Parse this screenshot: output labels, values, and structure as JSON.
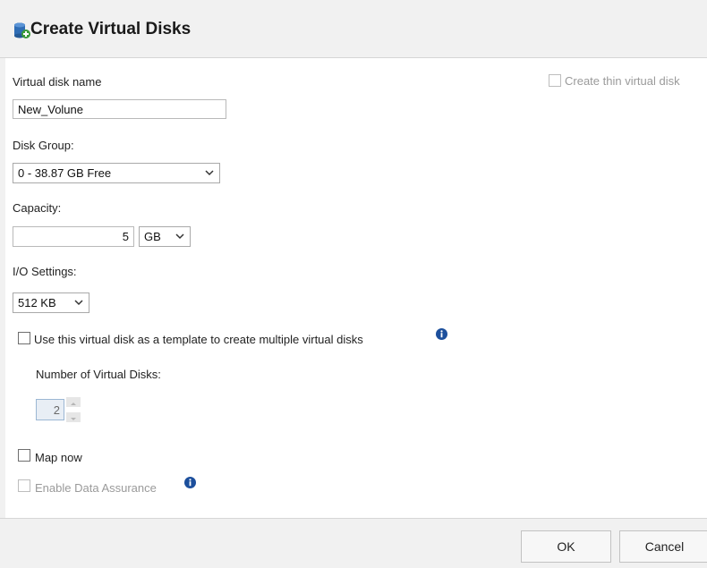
{
  "dialog": {
    "title": "Create Virtual Disks",
    "title_icon": "virtual-disk-add-icon"
  },
  "form": {
    "virtual_disk_name_label": "Virtual disk name",
    "virtual_disk_name_value": "New_Volune",
    "thin_disk_label": "Create thin virtual disk",
    "thin_disk_checked": false,
    "thin_disk_enabled": false,
    "disk_group_label": "Disk Group:",
    "disk_group_value": "0 - 38.87 GB Free",
    "capacity_label": "Capacity:",
    "capacity_value": "5",
    "capacity_unit": "GB",
    "io_settings_label": "I/O Settings:",
    "io_settings_value": "512 KB",
    "template_label": "Use this virtual disk as a template to create multiple virtual disks",
    "template_checked": false,
    "num_disks_label": "Number of Virtual Disks:",
    "num_disks_value": "2",
    "map_now_label": "Map now",
    "map_now_checked": false,
    "data_assurance_label": "Enable Data Assurance",
    "data_assurance_enabled": false
  },
  "footer": {
    "ok_label": "OK",
    "cancel_label": "Cancel"
  },
  "colors": {
    "header_bg": "#f1f1f1",
    "disabled_text": "#9a9a9a",
    "info_icon": "#1c4f9c"
  }
}
